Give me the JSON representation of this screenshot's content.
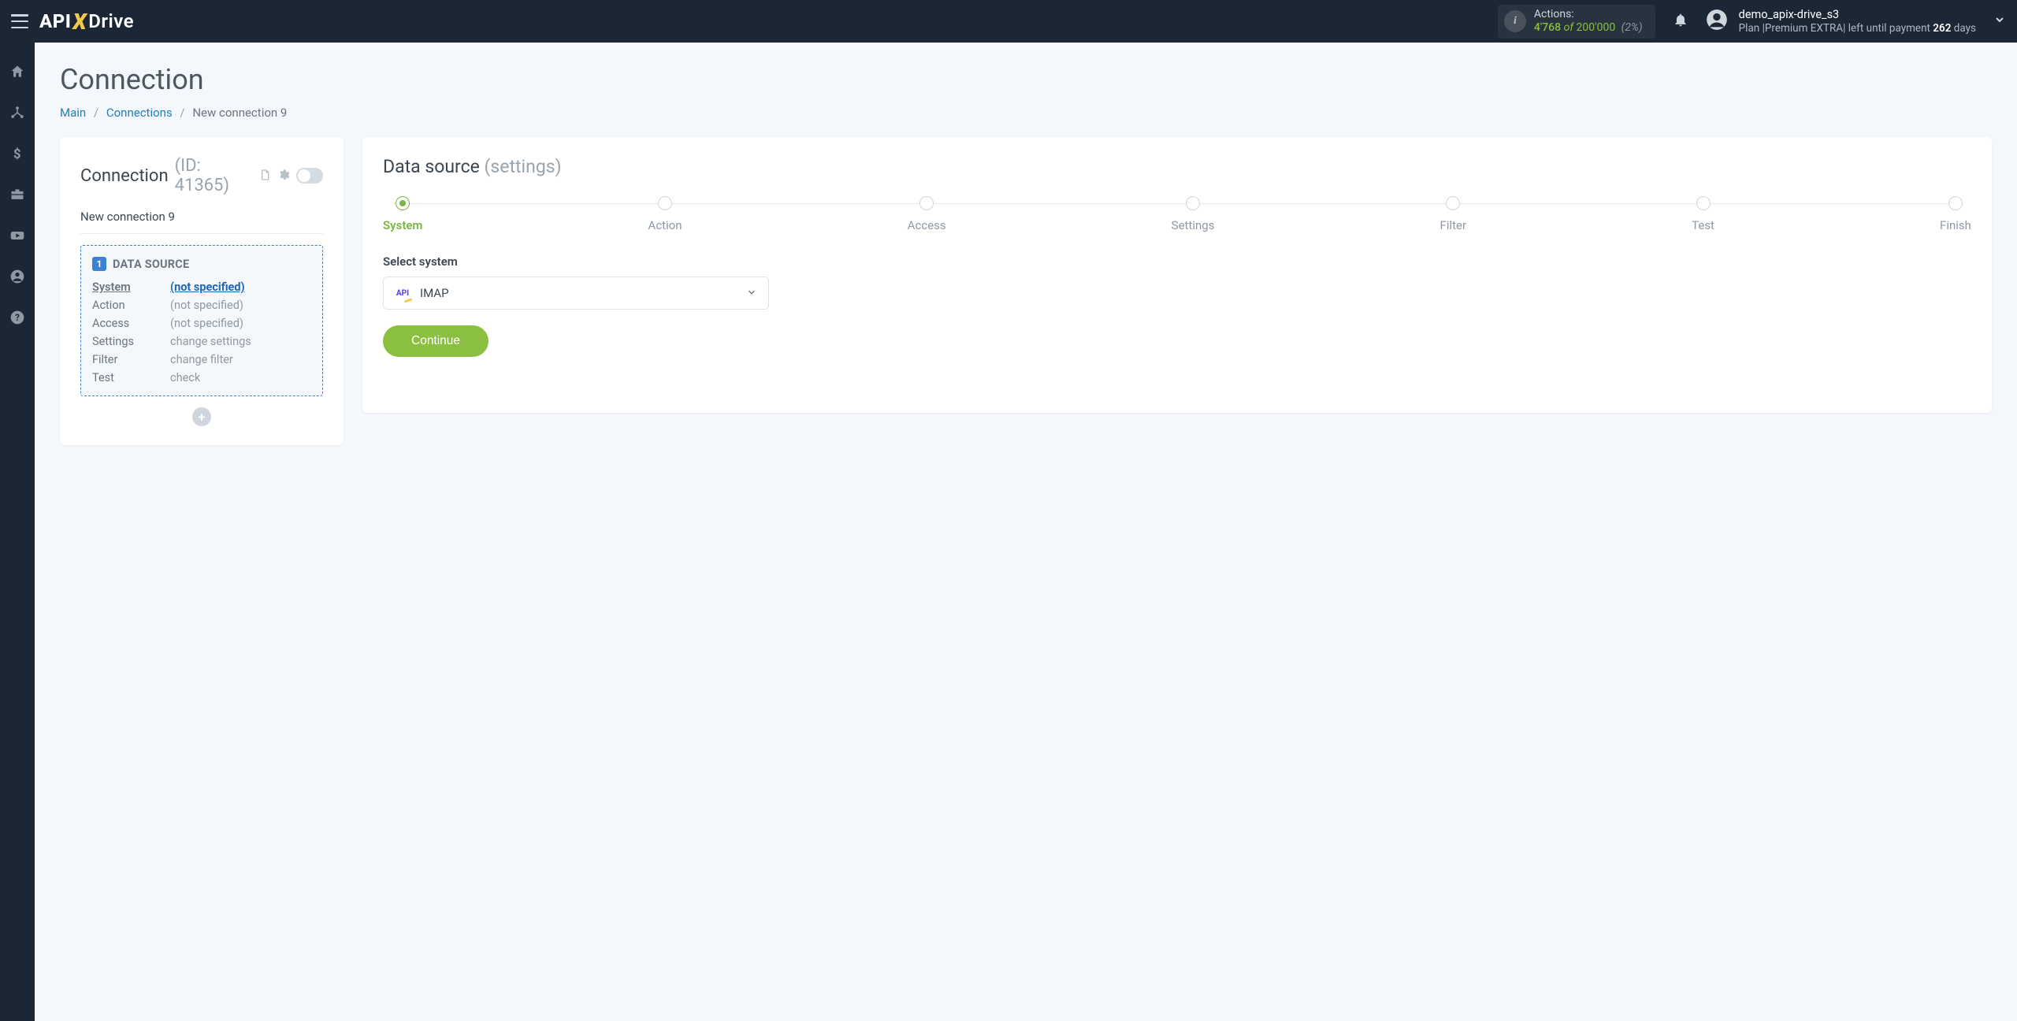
{
  "header": {
    "brand_api": "API",
    "brand_x": "X",
    "brand_drive": "Drive",
    "actions_label": "Actions:",
    "actions_used": "4'768",
    "actions_of": "of",
    "actions_total": "200'000",
    "actions_pct": "(2%)",
    "user_name": "demo_apix-drive_s3",
    "plan_prefix": "Plan |",
    "plan_name": "Premium EXTRA",
    "plan_mid": "| left until payment ",
    "plan_days_num": "262",
    "plan_days_suffix": " days"
  },
  "page": {
    "title": "Connection",
    "crumb_main": "Main",
    "crumb_connections": "Connections",
    "crumb_current": "New connection 9"
  },
  "left": {
    "conn_label": "Connection",
    "conn_id_text": "(ID: 41365)",
    "conn_name": "New connection 9",
    "ds_badge": "1",
    "ds_title": "DATA SOURCE",
    "rows": [
      {
        "k": "System",
        "k_active": true,
        "v": "(not specified)",
        "v_link": true
      },
      {
        "k": "Action",
        "k_active": false,
        "v": "(not specified)",
        "v_link": false
      },
      {
        "k": "Access",
        "k_active": false,
        "v": "(not specified)",
        "v_link": false
      },
      {
        "k": "Settings",
        "k_active": false,
        "v": "change settings",
        "v_link": false
      },
      {
        "k": "Filter",
        "k_active": false,
        "v": "change filter",
        "v_link": false
      },
      {
        "k": "Test",
        "k_active": false,
        "v": "check",
        "v_link": false
      }
    ],
    "add": "+"
  },
  "right": {
    "title_main": "Data source ",
    "title_sub": "(settings)",
    "steps": [
      "System",
      "Action",
      "Access",
      "Settings",
      "Filter",
      "Test",
      "Finish"
    ],
    "active_step": 0,
    "select_label": "Select system",
    "select_value": "IMAP",
    "continue": "Continue"
  }
}
